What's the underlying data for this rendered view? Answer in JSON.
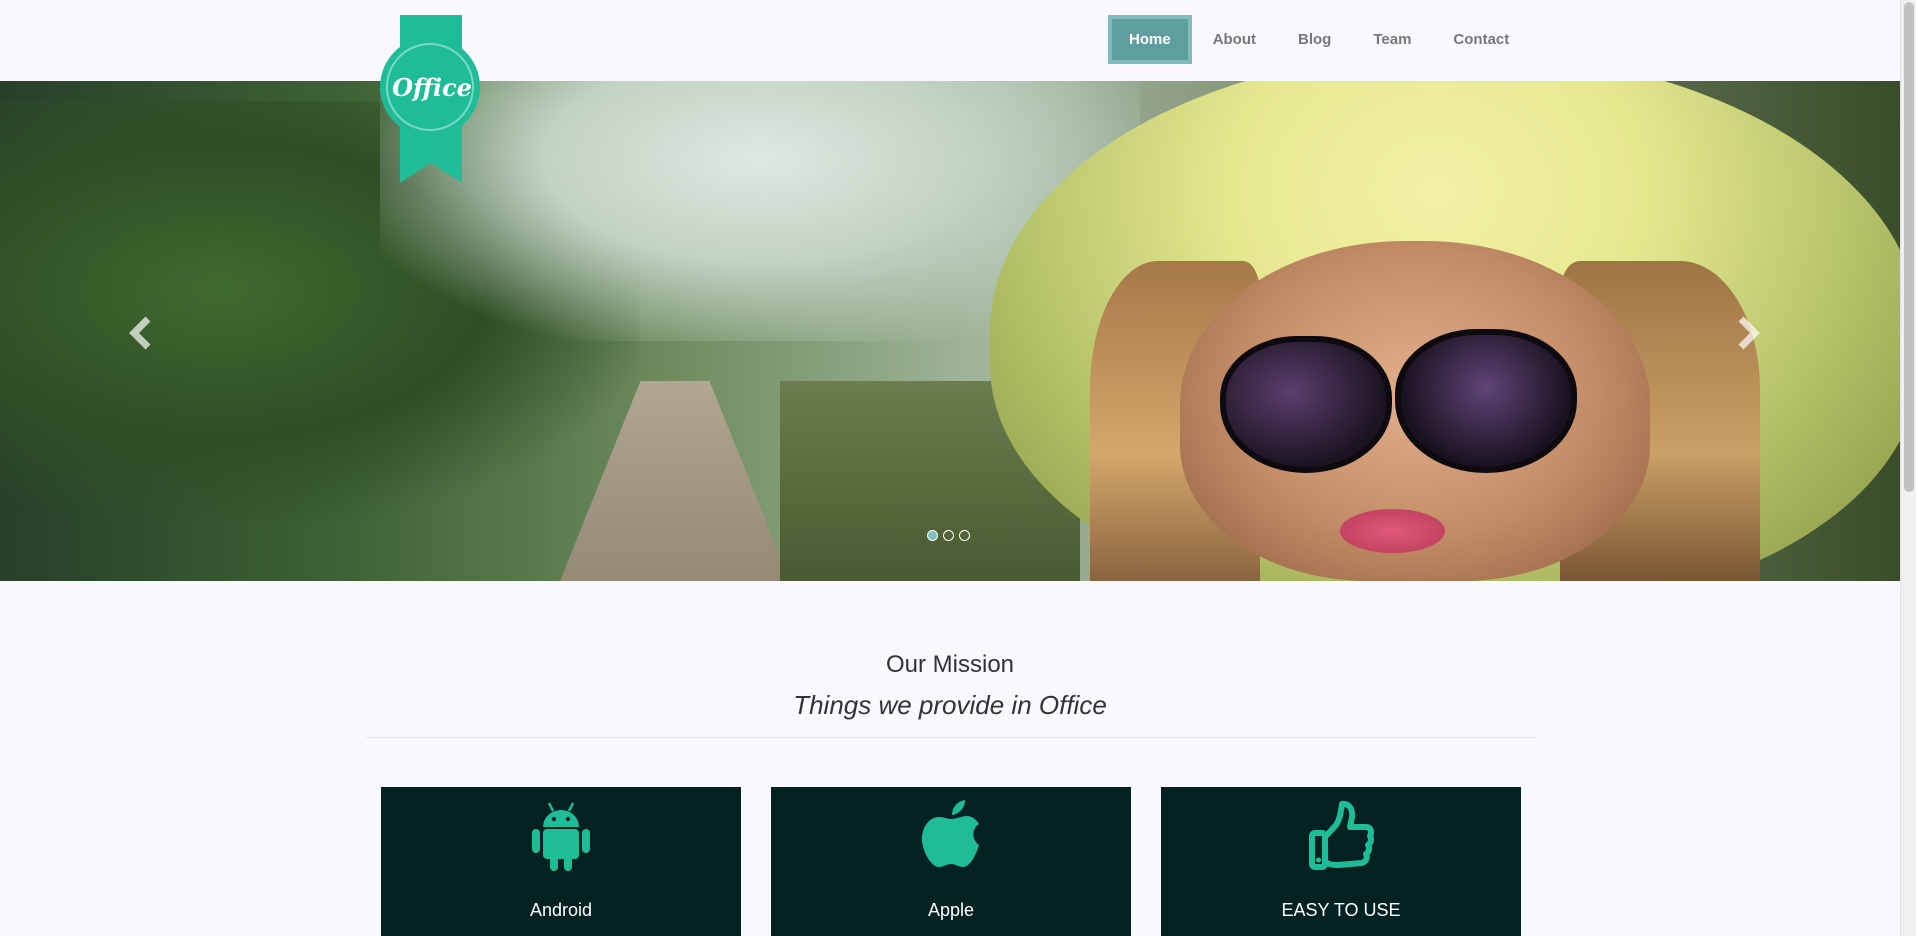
{
  "logo": {
    "text": "Office"
  },
  "nav": {
    "items": [
      {
        "label": "Home",
        "active": true
      },
      {
        "label": "About",
        "active": false
      },
      {
        "label": "Blog",
        "active": false
      },
      {
        "label": "Team",
        "active": false
      },
      {
        "label": "Contact",
        "active": false
      }
    ]
  },
  "carousel": {
    "prev_icon": "chevron-left-icon",
    "next_icon": "chevron-right-icon",
    "slide_count": 3,
    "active_slide": 1
  },
  "mission": {
    "title": "Our Mission",
    "subtitle": "Things we provide in Office"
  },
  "features": [
    {
      "label": "Android",
      "icon": "android-icon"
    },
    {
      "label": "Apple",
      "icon": "apple-icon"
    },
    {
      "label": "EASY TO USE",
      "icon": "thumbs-up-icon"
    }
  ],
  "colors": {
    "accent": "#1ebc97",
    "nav_active": "#5e9e9e",
    "feature_bg": "#052223",
    "page_bg": "#f8f8fe"
  }
}
